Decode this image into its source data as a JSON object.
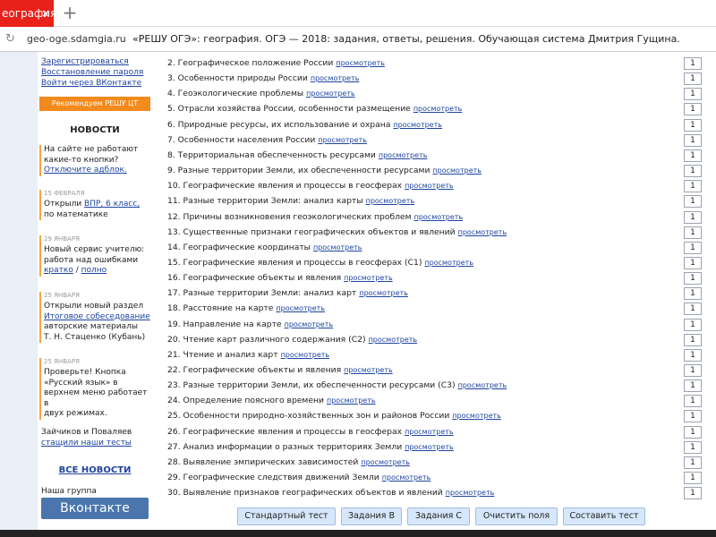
{
  "browser": {
    "tab_title": "еография.",
    "tab_close": "×",
    "new_tab": "+",
    "reload_icon": "↻",
    "url": "geo-oge.sdamgia.ru",
    "page_title": "«РЕШУ ОГЭ»: география. ОГЭ — 2018: задания, ответы, решения. Обучающая система Дмитрия Гущина."
  },
  "sidebar": {
    "register": "Зарегистрироваться",
    "restore_password": "Восстановление пароля",
    "login_vk": "Войти через ВКонтакте",
    "recommend": "Рекомендуем РЕШУ ЦТ",
    "news_title": "НОВОСТИ",
    "news1_line1": "На сайте не работают",
    "news1_line2": "какие-то кнопки?",
    "news1_link": "Отключите адблок.",
    "news2_date": "15 февраля",
    "news2_pre": "Открыли ",
    "news2_link": "ВПР, 6 класс,",
    "news2_line2": "по математике",
    "news3_date": "29 января",
    "news3_line1": "Новый сервис учителю:",
    "news3_line2": "работа над ошибками",
    "news3_link1": "кратко",
    "news3_sep": " / ",
    "news3_link2": "полно",
    "news4_date": "25 января",
    "news4_line1": "Открыли новый раздел",
    "news4_link": "Итоговое собеседование",
    "news4_line2": "авторские материалы",
    "news4_line3": "Т. Н. Стаценко (Кубань)",
    "news5_date": "25 января",
    "news5_line1": "Проверьте! Кнопка",
    "news5_line2": "«Русский язык» в",
    "news5_line3": "верхнем меню работает в",
    "news5_line4": "двух режимах.",
    "news6_line1": "Зайчиков и Поваляев",
    "news6_link": "стащили наши тесты",
    "all_news": "ВСЕ НОВОСТИ",
    "group_label": "Наша группа",
    "vk_button": "Вконтакте"
  },
  "tasks": [
    {
      "title": "2. Географическое положение России",
      "link": "просмотреть",
      "count": "1"
    },
    {
      "title": "3. Особенности природы России",
      "link": "просмотреть",
      "count": "1"
    },
    {
      "title": "4. Геоэкологические проблемы",
      "link": "просмотреть",
      "count": "1"
    },
    {
      "title": "5. Отрасли хозяйства России, особенности размещение",
      "link": "просмотреть",
      "count": "1"
    },
    {
      "title": "6. Природные ресурсы, их использование и охрана",
      "link": "просмотреть",
      "count": "1"
    },
    {
      "title": "7. Особенности населения России",
      "link": "просмотреть",
      "count": "1"
    },
    {
      "title": "8. Территориальная обеспеченность ресурсами",
      "link": "просмотреть",
      "count": "1"
    },
    {
      "title": "9. Разные территории Земли, их обеспеченности ресурсами",
      "link": "просмотреть",
      "count": "1"
    },
    {
      "title": "10. Географические явления и процессы в геосферах",
      "link": "просмотреть",
      "count": "1"
    },
    {
      "title": "11. Разные территории Земли: анализ карты",
      "link": "просмотреть",
      "count": "1"
    },
    {
      "title": "12. Причины возникновения геоэкологических проблем",
      "link": "просмотреть",
      "count": "1"
    },
    {
      "title": "13. Существенные признаки географических объектов и явлений",
      "link": "просмотреть",
      "count": "1"
    },
    {
      "title": "14. Географические координаты",
      "link": "просмотреть",
      "count": "1"
    },
    {
      "title": "15. Географические явления и процессы в геосферах (С1)",
      "link": "просмотреть",
      "count": "1"
    },
    {
      "title": "16. Географические объекты и явления",
      "link": "просмотреть",
      "count": "1"
    },
    {
      "title": "17. Разные территории Земли: анализ карт",
      "link": "просмотреть",
      "count": "1"
    },
    {
      "title": "18. Расстояние на карте",
      "link": "просмотреть",
      "count": "1"
    },
    {
      "title": "19. Направление на карте",
      "link": "просмотреть",
      "count": "1"
    },
    {
      "title": "20. Чтение карт различного содержания (С2)",
      "link": "просмотреть",
      "count": "1"
    },
    {
      "title": "21. Чтение и анализ карт",
      "link": "просмотреть",
      "count": "1"
    },
    {
      "title": "22. Географические объекты и явления",
      "link": "просмотреть",
      "count": "1"
    },
    {
      "title": "23. Разные территории Земли, их обеспеченности ресурсами (С3)",
      "link": "просмотреть",
      "count": "1"
    },
    {
      "title": "24. Определение поясного времени",
      "link": "просмотреть",
      "count": "1"
    },
    {
      "title": "25. Особенности природно-хозяйственных зон и районов России",
      "link": "просмотреть",
      "count": "1"
    },
    {
      "title": "26. Географические явления и процессы в геосферах",
      "link": "просмотреть",
      "count": "1"
    },
    {
      "title": "27. Анализ информации о разных территориях Земли",
      "link": "просмотреть",
      "count": "1"
    },
    {
      "title": "28. Выявление эмпирических зависимостей",
      "link": "просмотреть",
      "count": "1"
    },
    {
      "title": "29. Географические следствия движений Земли",
      "link": "просмотреть",
      "count": "1"
    },
    {
      "title": "30. Выявление признаков географических объектов и явлений",
      "link": "просмотреть",
      "count": "1"
    }
  ],
  "buttons": {
    "standard": "Стандартный тест",
    "tasks_b": "Задания В",
    "tasks_c": "Задания С",
    "clear": "Очистить поля",
    "compose": "Составить тест"
  },
  "colors": {
    "tab_red": "#e8211b",
    "link_blue": "#1e44a0",
    "orange": "#f28a1d",
    "vk_blue": "#4a76ad",
    "button_bg": "#d7e7fb"
  }
}
